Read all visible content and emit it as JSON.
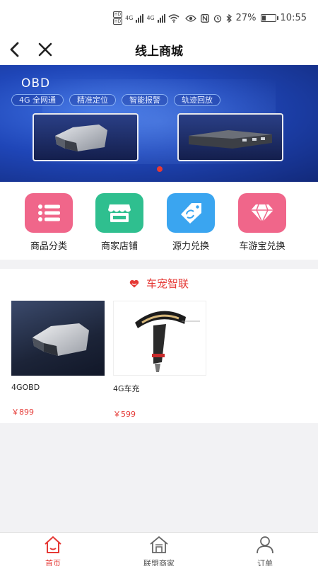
{
  "status_bar": {
    "hd1": "HD",
    "hd2": "HD",
    "net1": "4G",
    "net2": "4G",
    "battery": "27%",
    "battery_level": 0.27,
    "time": "10:55"
  },
  "nav": {
    "title": "线上商城",
    "back_icon": "chevron-left-icon",
    "close_icon": "close-icon"
  },
  "banner": {
    "title": "OBD",
    "tags": [
      "4G 全网通",
      "精准定位",
      "智能报警",
      "轨迹回放"
    ],
    "active_slide": 1
  },
  "menu": [
    {
      "label": "商品分类",
      "icon": "list-icon",
      "color": "#f0668a"
    },
    {
      "label": "商家店铺",
      "icon": "store-icon",
      "color": "#2fbf8f"
    },
    {
      "label": "源力兑换",
      "icon": "exchange-tag-icon",
      "color": "#3aa5f0"
    },
    {
      "label": "车游宝兑换",
      "icon": "diamond-icon",
      "color": "#f0668a"
    }
  ],
  "section": {
    "title": "车宠智联",
    "products": [
      {
        "name": "4GOBD",
        "price": "￥899"
      },
      {
        "name": "4G车充",
        "price": "￥599"
      }
    ]
  },
  "tabbar": [
    {
      "label": "首页",
      "icon": "home-icon",
      "active": true
    },
    {
      "label": "联盟商家",
      "icon": "store-house-icon",
      "active": false
    },
    {
      "label": "订单",
      "icon": "user-icon",
      "active": false
    }
  ],
  "colors": {
    "accent": "#e53935"
  }
}
